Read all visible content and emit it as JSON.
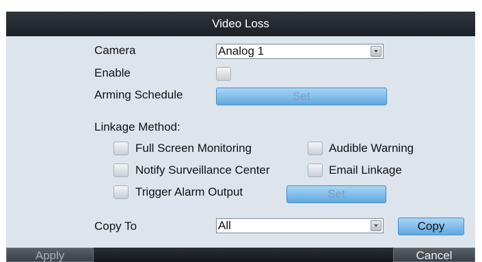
{
  "dialog": {
    "title": "Video Loss",
    "camera_label": "Camera",
    "camera_value": "Analog 1",
    "enable_label": "Enable",
    "arming_label": "Arming Schedule",
    "arming_button": "Set",
    "linkage_label": "Linkage Method:",
    "options": {
      "full_screen": "Full Screen Monitoring",
      "audible": "Audible Warning",
      "notify_center": "Notify Surveillance Center",
      "email": "Email Linkage",
      "trigger_alarm": "Trigger Alarm Output"
    },
    "trigger_button": "Set",
    "copy_label": "Copy To",
    "copy_value": "All",
    "copy_button": "Copy"
  },
  "footer": {
    "apply": "Apply",
    "cancel": "Cancel"
  },
  "icons": {
    "dropdown": "chevron-down-icon"
  },
  "colors": {
    "title_bg": "#1d2126",
    "panel_bg": "#dde4ec",
    "button_blue": "#5fa8df"
  }
}
